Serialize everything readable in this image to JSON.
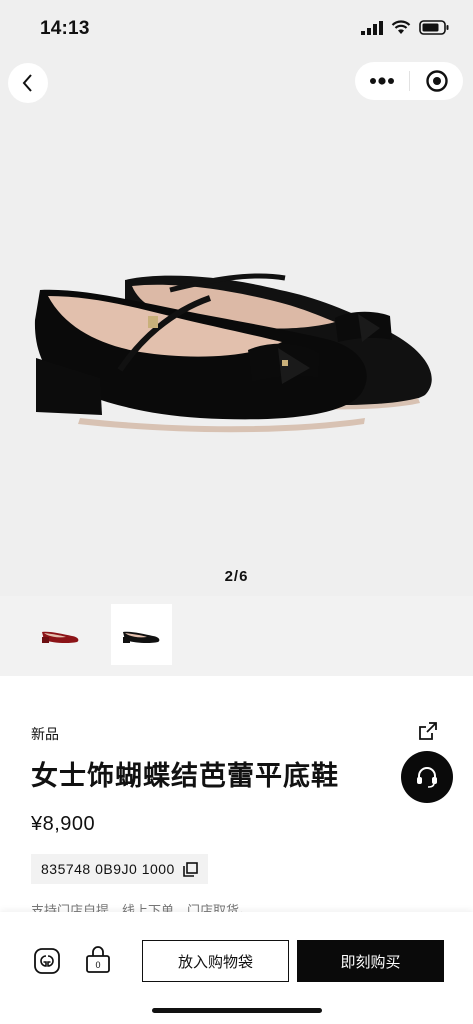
{
  "status_bar": {
    "time": "14:13"
  },
  "gallery": {
    "pager": "2/6"
  },
  "product": {
    "badge": "新品",
    "title": "女士饰蝴蝶结芭蕾平底鞋",
    "price": "¥8,900",
    "sku": "835748 0B9J0 1000",
    "note": "支持门店自提、线上下单、门店取货。"
  },
  "actions": {
    "add_to_cart": "放入购物袋",
    "buy_now": "即刻购买",
    "bag_count": "0"
  },
  "icons": [
    "back-icon",
    "more-icon",
    "target-icon",
    "share-icon",
    "headset-icon",
    "gucci-logo-icon",
    "shopping-bag-icon",
    "copy-icon"
  ],
  "colors": {
    "accent": "#0a0a0a",
    "hero_bg": "#efefef"
  }
}
